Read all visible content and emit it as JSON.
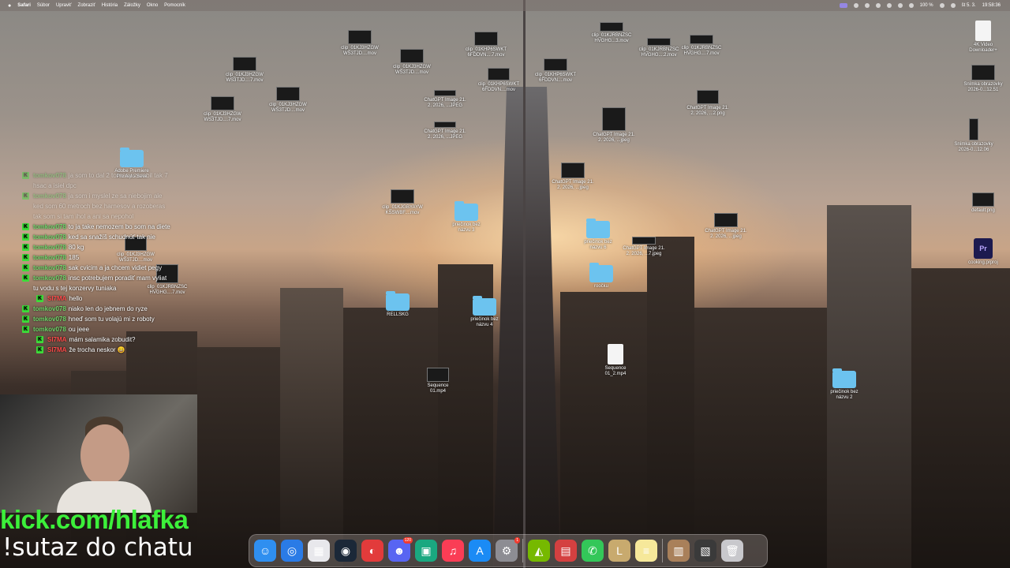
{
  "menubar": {
    "apple": "",
    "items": [
      "Safari",
      "Súbor",
      "Upraviť",
      "Zobraziť",
      "História",
      "Záložky",
      "Okno",
      "Pomocník"
    ],
    "status_battery": "100 %",
    "status_date": "št 5. 3.",
    "status_time": "19:58:36"
  },
  "desktop": {
    "icons": [
      {
        "label": "clip_01KJ3HZGW\nWS3TJD....7.mov",
        "kind": "thumb"
      },
      {
        "label": "clip_01KJ3HZGW\nWS3TJD....7.mov",
        "kind": "thumb"
      },
      {
        "label": "clip_01KJ3HZGW\nWS3TJD....mov",
        "kind": "thumb"
      },
      {
        "label": "clip_01KJ3HZGW\nWS3TJD....mov",
        "kind": "thumb"
      },
      {
        "label": "clip_01KJ3HZGW\nWS3TJD....mov",
        "kind": "thumb"
      },
      {
        "label": "clip_01KHP6SWKT\n6FDDVN....7.mov",
        "kind": "thumb"
      },
      {
        "label": "clip_01KHP6SWKT\n6FDDVN....mov",
        "kind": "thumb"
      },
      {
        "label": "clip_01KHP6SWKT\n6FDDVN....mov",
        "kind": "thumb"
      },
      {
        "label": "clip_01KJRBNZSC\nHVGHG...3.mov",
        "kind": "thumb"
      },
      {
        "label": "clip_01KJRBNZSC\nHVGHG....2.mov",
        "kind": "thumb"
      },
      {
        "label": "clip_01KJRBNZSC\nHVGHG....7.mov",
        "kind": "thumb"
      },
      {
        "label": "ChatGPT Image 21.\n2. 2026, ...JPEG",
        "kind": "thumb"
      },
      {
        "label": "ChatGPT Image 21.\n2. 2026, ...JPEG",
        "kind": "thumb"
      },
      {
        "label": "ChatGPT Image 21.\n2. 2026, ...jpeg",
        "kind": "thumb"
      },
      {
        "label": "ChatGPT Image 21.\n2. 2026, ...jpeg",
        "kind": "thumb"
      },
      {
        "label": "ChatGPT Image 21.\n2. 2026, ...7.jpeg",
        "kind": "thumb"
      },
      {
        "label": "ChatGPT Image 21.\n2. 2026, ...jpeg",
        "kind": "thumb"
      },
      {
        "label": "ChatGPT Image 21.\n2. 2026, ...2.png",
        "kind": "thumb"
      },
      {
        "label": "priečinok bez\nnázvu 3",
        "kind": "folder"
      },
      {
        "label": "priečinok bez\nnázvu 4",
        "kind": "folder"
      },
      {
        "label": "priečinok bez\nnázvu 2",
        "kind": "folder"
      },
      {
        "label": "priečinok bez\nnázvu 6",
        "kind": "folder"
      },
      {
        "label": "roočku",
        "kind": "folder"
      },
      {
        "label": "RELLSKG",
        "kind": "folder"
      },
      {
        "label": "Sequence\n01.mp4",
        "kind": "thumb"
      },
      {
        "label": "Sequence\n01_2.mp4",
        "kind": "file"
      },
      {
        "label": "4K Video\nDownloader+",
        "kind": "file"
      },
      {
        "label": "Snímka obrazovky\n2026-0...12.51",
        "kind": "thumb"
      },
      {
        "label": "Snímka obrazovky\n2026-0...12.06",
        "kind": "thumb"
      },
      {
        "label": "default.png",
        "kind": "thumb"
      },
      {
        "label": "cooking.prproj",
        "kind": "premiere"
      },
      {
        "label": "Adobe Premiere\nPro Auto-Save",
        "kind": "folder"
      },
      {
        "label": "clip_01KJ3HZGW\nWS3TJD....mov",
        "kind": "thumb"
      },
      {
        "label": "clip_01KJRBNZSC\nHVGHG....7.mov",
        "kind": "thumb"
      },
      {
        "label": "clip_01KJGBYAYW\nKSSWBF....mov",
        "kind": "thumb"
      }
    ]
  },
  "chat": {
    "messages": [
      {
        "user": "tomkov078",
        "text": "ja som to dal 2 tornasy zarobil tak 7 hsac a isiel dpc",
        "faded": true,
        "indent": false
      },
      {
        "user": "tomkov078",
        "text": "ja som i myslel ze sa niebojim ale ked som 60 metroch bez harnesov a rozoberas tak som si tam ihol a ani sa nepohol",
        "faded": true,
        "indent": false
      },
      {
        "user": "tomkov078",
        "text": "to ja take nemozem bo som na diete",
        "faded": false,
        "indent": false
      },
      {
        "user": "tomkov078",
        "text": "ked sa snažíš schudnúť tak nie",
        "faded": false,
        "indent": false
      },
      {
        "user": "tomkov078",
        "text": "80 kg",
        "faded": false,
        "indent": false
      },
      {
        "user": "tomkov078",
        "text": "185",
        "faded": false,
        "indent": false
      },
      {
        "user": "tomkov078",
        "text": "sak cvicim a ja chcem vidiet pegy",
        "faded": false,
        "indent": false
      },
      {
        "user": "tomkov078",
        "text": "insc potrebujem poradiť mam vyliat tu vodu s tej konzervy tuniaka",
        "faded": false,
        "indent": false
      },
      {
        "user": "SI7MA",
        "text": "hello",
        "faded": false,
        "indent": true,
        "red": true
      },
      {
        "user": "tomkov078",
        "text": "niako len do jebnem do ryze",
        "faded": false,
        "indent": false
      },
      {
        "user": "tomkov078",
        "text": "hneď som tu volajú mi z roboty",
        "faded": false,
        "indent": false
      },
      {
        "user": "tomkov078",
        "text": "ou jeee",
        "faded": false,
        "indent": false
      },
      {
        "user": "SI7MA",
        "text": "mám salamika zobudit?",
        "faded": false,
        "indent": true,
        "red": true
      },
      {
        "user": "SI7MA",
        "text": "že trocha neskor 😄",
        "faded": false,
        "indent": true,
        "red": true
      }
    ]
  },
  "overlay": {
    "kick_url": "kick.com/hlafka",
    "sutaz": "!sutaz do chatu"
  },
  "dock": {
    "apps": [
      {
        "name": "finder",
        "glyph": "☺",
        "color": "#2f8ff0"
      },
      {
        "name": "safari",
        "glyph": "◎",
        "color": "#2a7be6"
      },
      {
        "name": "launchpad",
        "glyph": "▦",
        "color": "#e8e8ec"
      },
      {
        "name": "steam",
        "glyph": "◉",
        "color": "#1b2838"
      },
      {
        "name": "pocketcasts",
        "glyph": "◐",
        "color": "#e23b3b"
      },
      {
        "name": "discord",
        "glyph": "☻",
        "color": "#5865f2",
        "badge": "120"
      },
      {
        "name": "terminal-app",
        "glyph": "▣",
        "color": "#1aa880"
      },
      {
        "name": "music",
        "glyph": "♫",
        "color": "#fa3d55"
      },
      {
        "name": "app-store",
        "glyph": "A",
        "color": "#1b8bf5"
      },
      {
        "name": "system-settings",
        "glyph": "⚙",
        "color": "#8d8d93",
        "badge": "1"
      },
      {
        "name": "nvidia",
        "glyph": "◭",
        "color": "#76b900"
      },
      {
        "name": "calculator-app",
        "glyph": "▤",
        "color": "#d44040"
      },
      {
        "name": "phone",
        "glyph": "✆",
        "color": "#33c759"
      },
      {
        "name": "league",
        "glyph": "L",
        "color": "#c8aa6e"
      },
      {
        "name": "notes",
        "glyph": "≡",
        "color": "#f6e89a"
      },
      {
        "name": "downloads",
        "glyph": "▥",
        "color": "#a9805a"
      },
      {
        "name": "screenshots",
        "glyph": "▧",
        "color": "#3a3a3a"
      },
      {
        "name": "trash",
        "glyph": "🗑",
        "color": "#c8c8cc"
      }
    ]
  }
}
